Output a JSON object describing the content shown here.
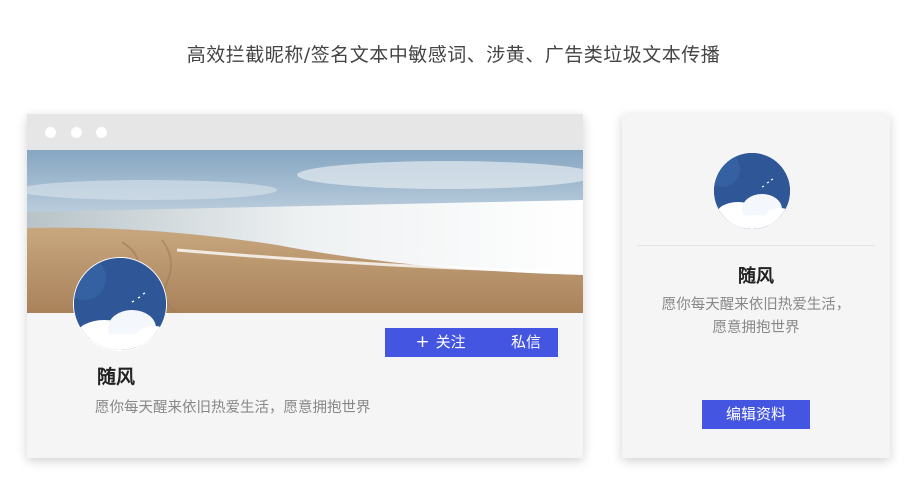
{
  "heading": "高效拦截昵称/签名文本中敏感词、涉黄、广告类垃圾文本传播",
  "profile_page": {
    "follow_button": {
      "icon": "plus-icon",
      "icon_glyph": "+",
      "label": "关注"
    },
    "message_button": "私信",
    "name": "随风",
    "signature": "愿你每天醒来依旧热爱生活，愿意拥抱世界"
  },
  "profile_card": {
    "name": "随风",
    "signature_line1": "愿你每天醒来依旧热爱生活，",
    "signature_line2": "愿意拥抱世界",
    "edit_button": "编辑资料"
  },
  "colors": {
    "accent": "#4455e2",
    "panel_bg": "#f5f5f5",
    "titlebar_bg": "#e6e6e6",
    "avatar_sky": "#2f5797"
  }
}
